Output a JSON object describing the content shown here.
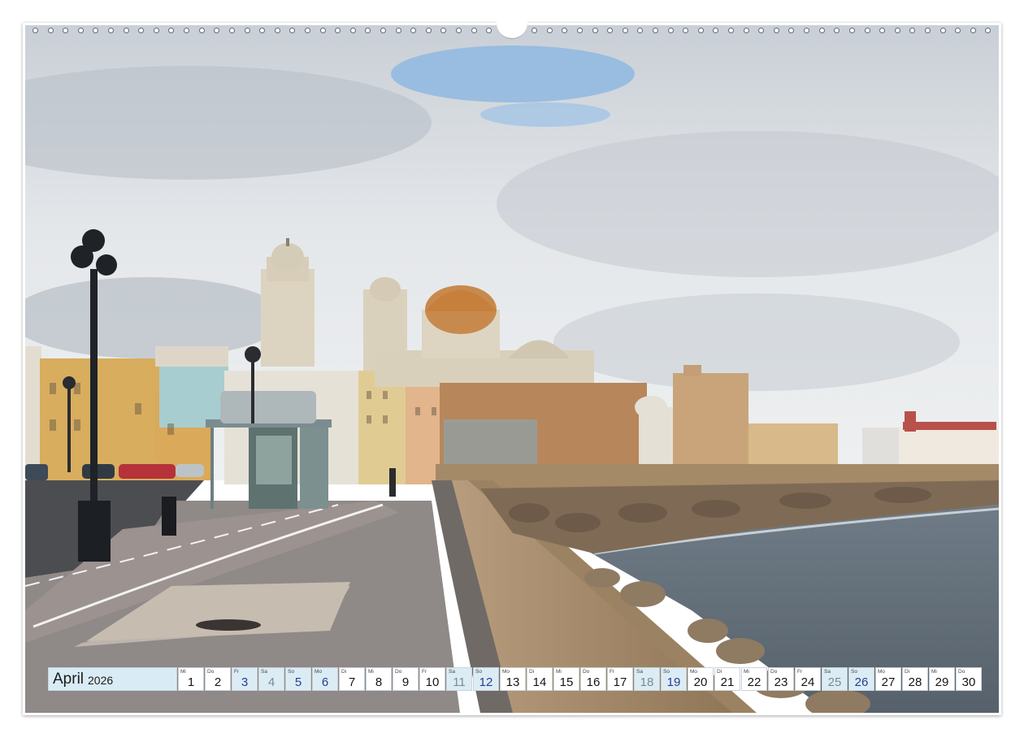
{
  "calendar": {
    "month": "April",
    "year": "2026",
    "days": [
      {
        "wd": "Mi",
        "num": "1",
        "type": "weekday"
      },
      {
        "wd": "Do",
        "num": "2",
        "type": "weekday"
      },
      {
        "wd": "Fr",
        "num": "3",
        "type": "holiday"
      },
      {
        "wd": "Sa",
        "num": "4",
        "type": "saturday"
      },
      {
        "wd": "So",
        "num": "5",
        "type": "sunday"
      },
      {
        "wd": "Mo",
        "num": "6",
        "type": "holiday"
      },
      {
        "wd": "Di",
        "num": "7",
        "type": "weekday"
      },
      {
        "wd": "Mi",
        "num": "8",
        "type": "weekday"
      },
      {
        "wd": "Do",
        "num": "9",
        "type": "weekday"
      },
      {
        "wd": "Fr",
        "num": "10",
        "type": "weekday"
      },
      {
        "wd": "Sa",
        "num": "11",
        "type": "saturday"
      },
      {
        "wd": "So",
        "num": "12",
        "type": "sunday"
      },
      {
        "wd": "Mo",
        "num": "13",
        "type": "weekday"
      },
      {
        "wd": "Di",
        "num": "14",
        "type": "weekday"
      },
      {
        "wd": "Mi",
        "num": "15",
        "type": "weekday"
      },
      {
        "wd": "Do",
        "num": "16",
        "type": "weekday"
      },
      {
        "wd": "Fr",
        "num": "17",
        "type": "weekday"
      },
      {
        "wd": "Sa",
        "num": "18",
        "type": "saturday"
      },
      {
        "wd": "So",
        "num": "19",
        "type": "sunday"
      },
      {
        "wd": "Mo",
        "num": "20",
        "type": "weekday"
      },
      {
        "wd": "Di",
        "num": "21",
        "type": "weekday"
      },
      {
        "wd": "Mi",
        "num": "22",
        "type": "weekday"
      },
      {
        "wd": "Do",
        "num": "23",
        "type": "weekday"
      },
      {
        "wd": "Fr",
        "num": "24",
        "type": "weekday"
      },
      {
        "wd": "Sa",
        "num": "25",
        "type": "saturday"
      },
      {
        "wd": "So",
        "num": "26",
        "type": "sunday"
      },
      {
        "wd": "Mo",
        "num": "27",
        "type": "weekday"
      },
      {
        "wd": "Di",
        "num": "28",
        "type": "weekday"
      },
      {
        "wd": "Mi",
        "num": "29",
        "type": "weekday"
      },
      {
        "wd": "Do",
        "num": "30",
        "type": "weekday"
      }
    ]
  },
  "colors": {
    "month_box": "#d9ecf6",
    "weekend_cell": "#dcecf5",
    "sunday_text": "#23408e",
    "saturday_text": "#7d8a95"
  }
}
